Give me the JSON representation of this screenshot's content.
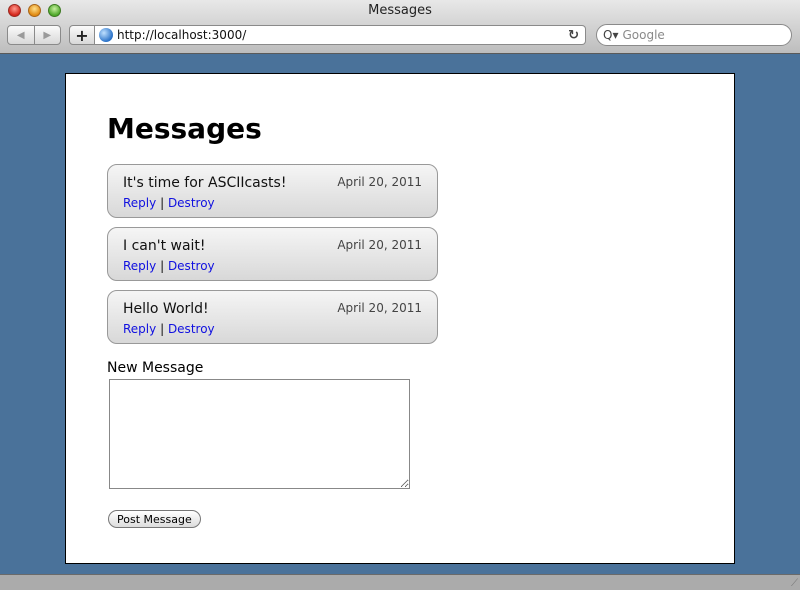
{
  "window": {
    "title": "Messages"
  },
  "toolbar": {
    "back_icon": "◀",
    "forward_icon": "▶",
    "add_icon": "+",
    "url": "http://localhost:3000/",
    "reload_icon": "↻",
    "search_icon": "Q▾",
    "search_placeholder": "Google"
  },
  "page": {
    "heading": "Messages",
    "messages": [
      {
        "content": "It's time for ASCIIcasts!",
        "date": "April 20, 2011",
        "reply_label": "Reply",
        "separator": "|",
        "destroy_label": "Destroy"
      },
      {
        "content": "I can't wait!",
        "date": "April 20, 2011",
        "reply_label": "Reply",
        "separator": "|",
        "destroy_label": "Destroy"
      },
      {
        "content": "Hello World!",
        "date": "April 20, 2011",
        "reply_label": "Reply",
        "separator": "|",
        "destroy_label": "Destroy"
      }
    ],
    "form": {
      "label": "New Message",
      "textarea_value": "",
      "submit_label": "Post Message"
    }
  },
  "colors": {
    "background": "#4a729a",
    "link": "#1010e0"
  }
}
